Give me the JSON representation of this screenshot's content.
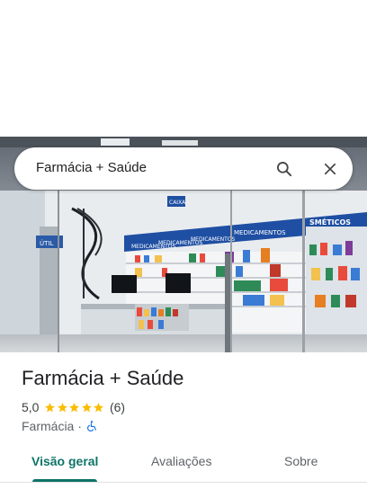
{
  "search": {
    "query": "Farmácia + Saúde",
    "search_icon": "search-icon",
    "close_icon": "close-icon"
  },
  "photo": {
    "signs": {
      "caixa": "CAIXA",
      "medicamentos": "MEDICAMENTOS",
      "cosmeticos": "SMÉTICOS",
      "util": "ÚTIL"
    }
  },
  "place": {
    "name": "Farmácia + Saúde",
    "rating": "5,0",
    "stars": 5,
    "review_count": "(6)",
    "category": "Farmácia",
    "separator": "·",
    "accessibility_icon": "wheelchair-icon"
  },
  "tabs": [
    {
      "label": "Visão geral",
      "active": true
    },
    {
      "label": "Avaliações",
      "active": false
    },
    {
      "label": "Sobre",
      "active": false
    }
  ],
  "colors": {
    "accent": "#0e7468",
    "star": "#fbbc04",
    "accessibility": "#1a73e8"
  }
}
